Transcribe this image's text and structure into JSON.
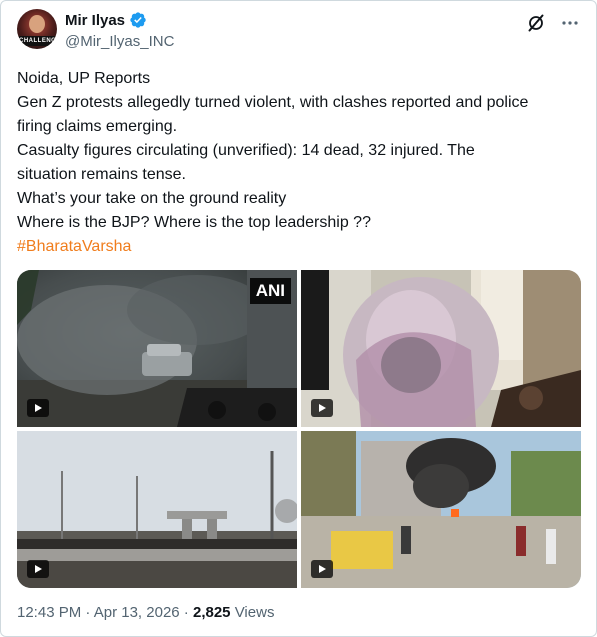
{
  "post": {
    "author_name": "Mir Ilyas",
    "author_handle": "@Mir_Ilyas_INC",
    "avatar_text": "CHALLENGE",
    "lines": [
      "Noida, UP Reports",
      "Gen Z protests allegedly turned violent, with clashes reported and police",
      "firing claims emerging.",
      "Casualty figures circulating (unverified): 14 dead, 32 injured. The",
      "situation remains tense.",
      "What’s your take on the ground reality",
      "Where is the BJP? Where is the top leadership ??"
    ],
    "hashtag": "#BharataVarsha",
    "time": "12:43 PM",
    "separator": " · ",
    "date": "Apr 13, 2026",
    "views_count": "2,825",
    "views_label": "Views"
  },
  "media": {
    "watermark": "ANI",
    "items": [
      "video",
      "video",
      "video",
      "video"
    ]
  },
  "colors": {
    "hashtag": "#f07d1d",
    "verified": "#1d9bf0",
    "muted": "#536471"
  },
  "icons": [
    "verified-badge-icon",
    "grok-icon",
    "more-icon",
    "play-icon"
  ]
}
